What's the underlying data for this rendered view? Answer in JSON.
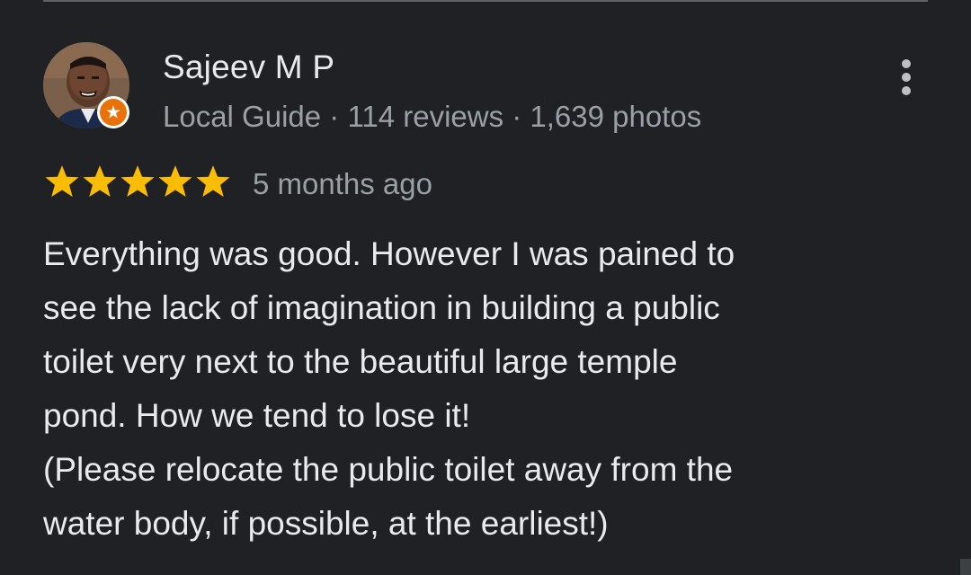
{
  "reviewer": {
    "name": "Sajeev M P",
    "meta": "Local Guide · 114 reviews · 1,639 photos",
    "badge_icon": "local-guide-star-icon",
    "avatar_icon": "avatar-photo"
  },
  "rating": {
    "stars": 5,
    "max": 5,
    "star_color": "#fbbc04",
    "time": "5 months ago"
  },
  "review": {
    "text": "Everything was good. However I was pained to\nsee the lack of imagination in building a public\ntoilet very next to the beautiful large temple\npond. How we tend to lose it!\n(Please relocate the public toilet away from the\nwater body, if possible, at the earliest!)"
  },
  "colors": {
    "background": "#202124",
    "primary_text": "#e8eaed",
    "secondary_text": "#9aa0a6",
    "badge_orange": "#e8710a"
  },
  "menu": {
    "icon": "more-vert-icon"
  }
}
